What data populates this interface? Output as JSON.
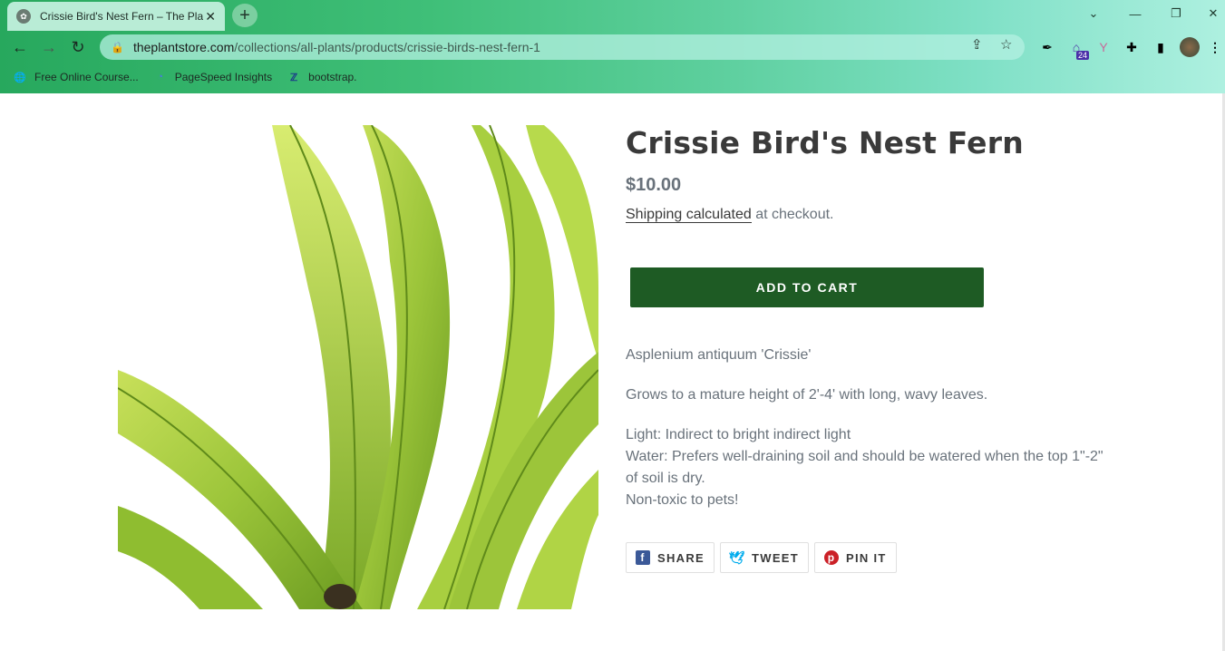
{
  "browser": {
    "tab_title": "Crissie Bird's Nest Fern – The Plant Store",
    "url_host": "theplantstore.com",
    "url_path": "/collections/all-plants/products/crissie-birds-nest-fern-1",
    "extension_badge": "24",
    "bookmarks": [
      {
        "label": "Free Online Course...",
        "icon": "globe-icon"
      },
      {
        "label": "PageSpeed Insights",
        "icon": "pagespeed-icon"
      },
      {
        "label": "bootstrap.",
        "icon": "bootstrap-icon"
      }
    ]
  },
  "product": {
    "title": "Crissie Bird's Nest Fern",
    "price": "$10.00",
    "shipping_link": "Shipping calculated",
    "shipping_rest": " at checkout.",
    "add_to_cart": "ADD TO CART",
    "description": {
      "line1": "Asplenium antiquum 'Crissie'",
      "line2": "Grows to a mature height of 2'-4' with long, wavy leaves.",
      "light": "Light: Indirect to bright indirect light",
      "water": "Water: Prefers well-draining soil and should be watered when the top 1\"-2\" of soil is dry.",
      "pets": "Non-toxic to pets!"
    },
    "share": {
      "facebook": "SHARE",
      "twitter": "TWEET",
      "pinterest": "PIN IT"
    }
  },
  "colors": {
    "cart_button": "#1e5b24",
    "facebook": "#3b5998",
    "twitter": "#00aced",
    "pinterest": "#cb2027"
  }
}
